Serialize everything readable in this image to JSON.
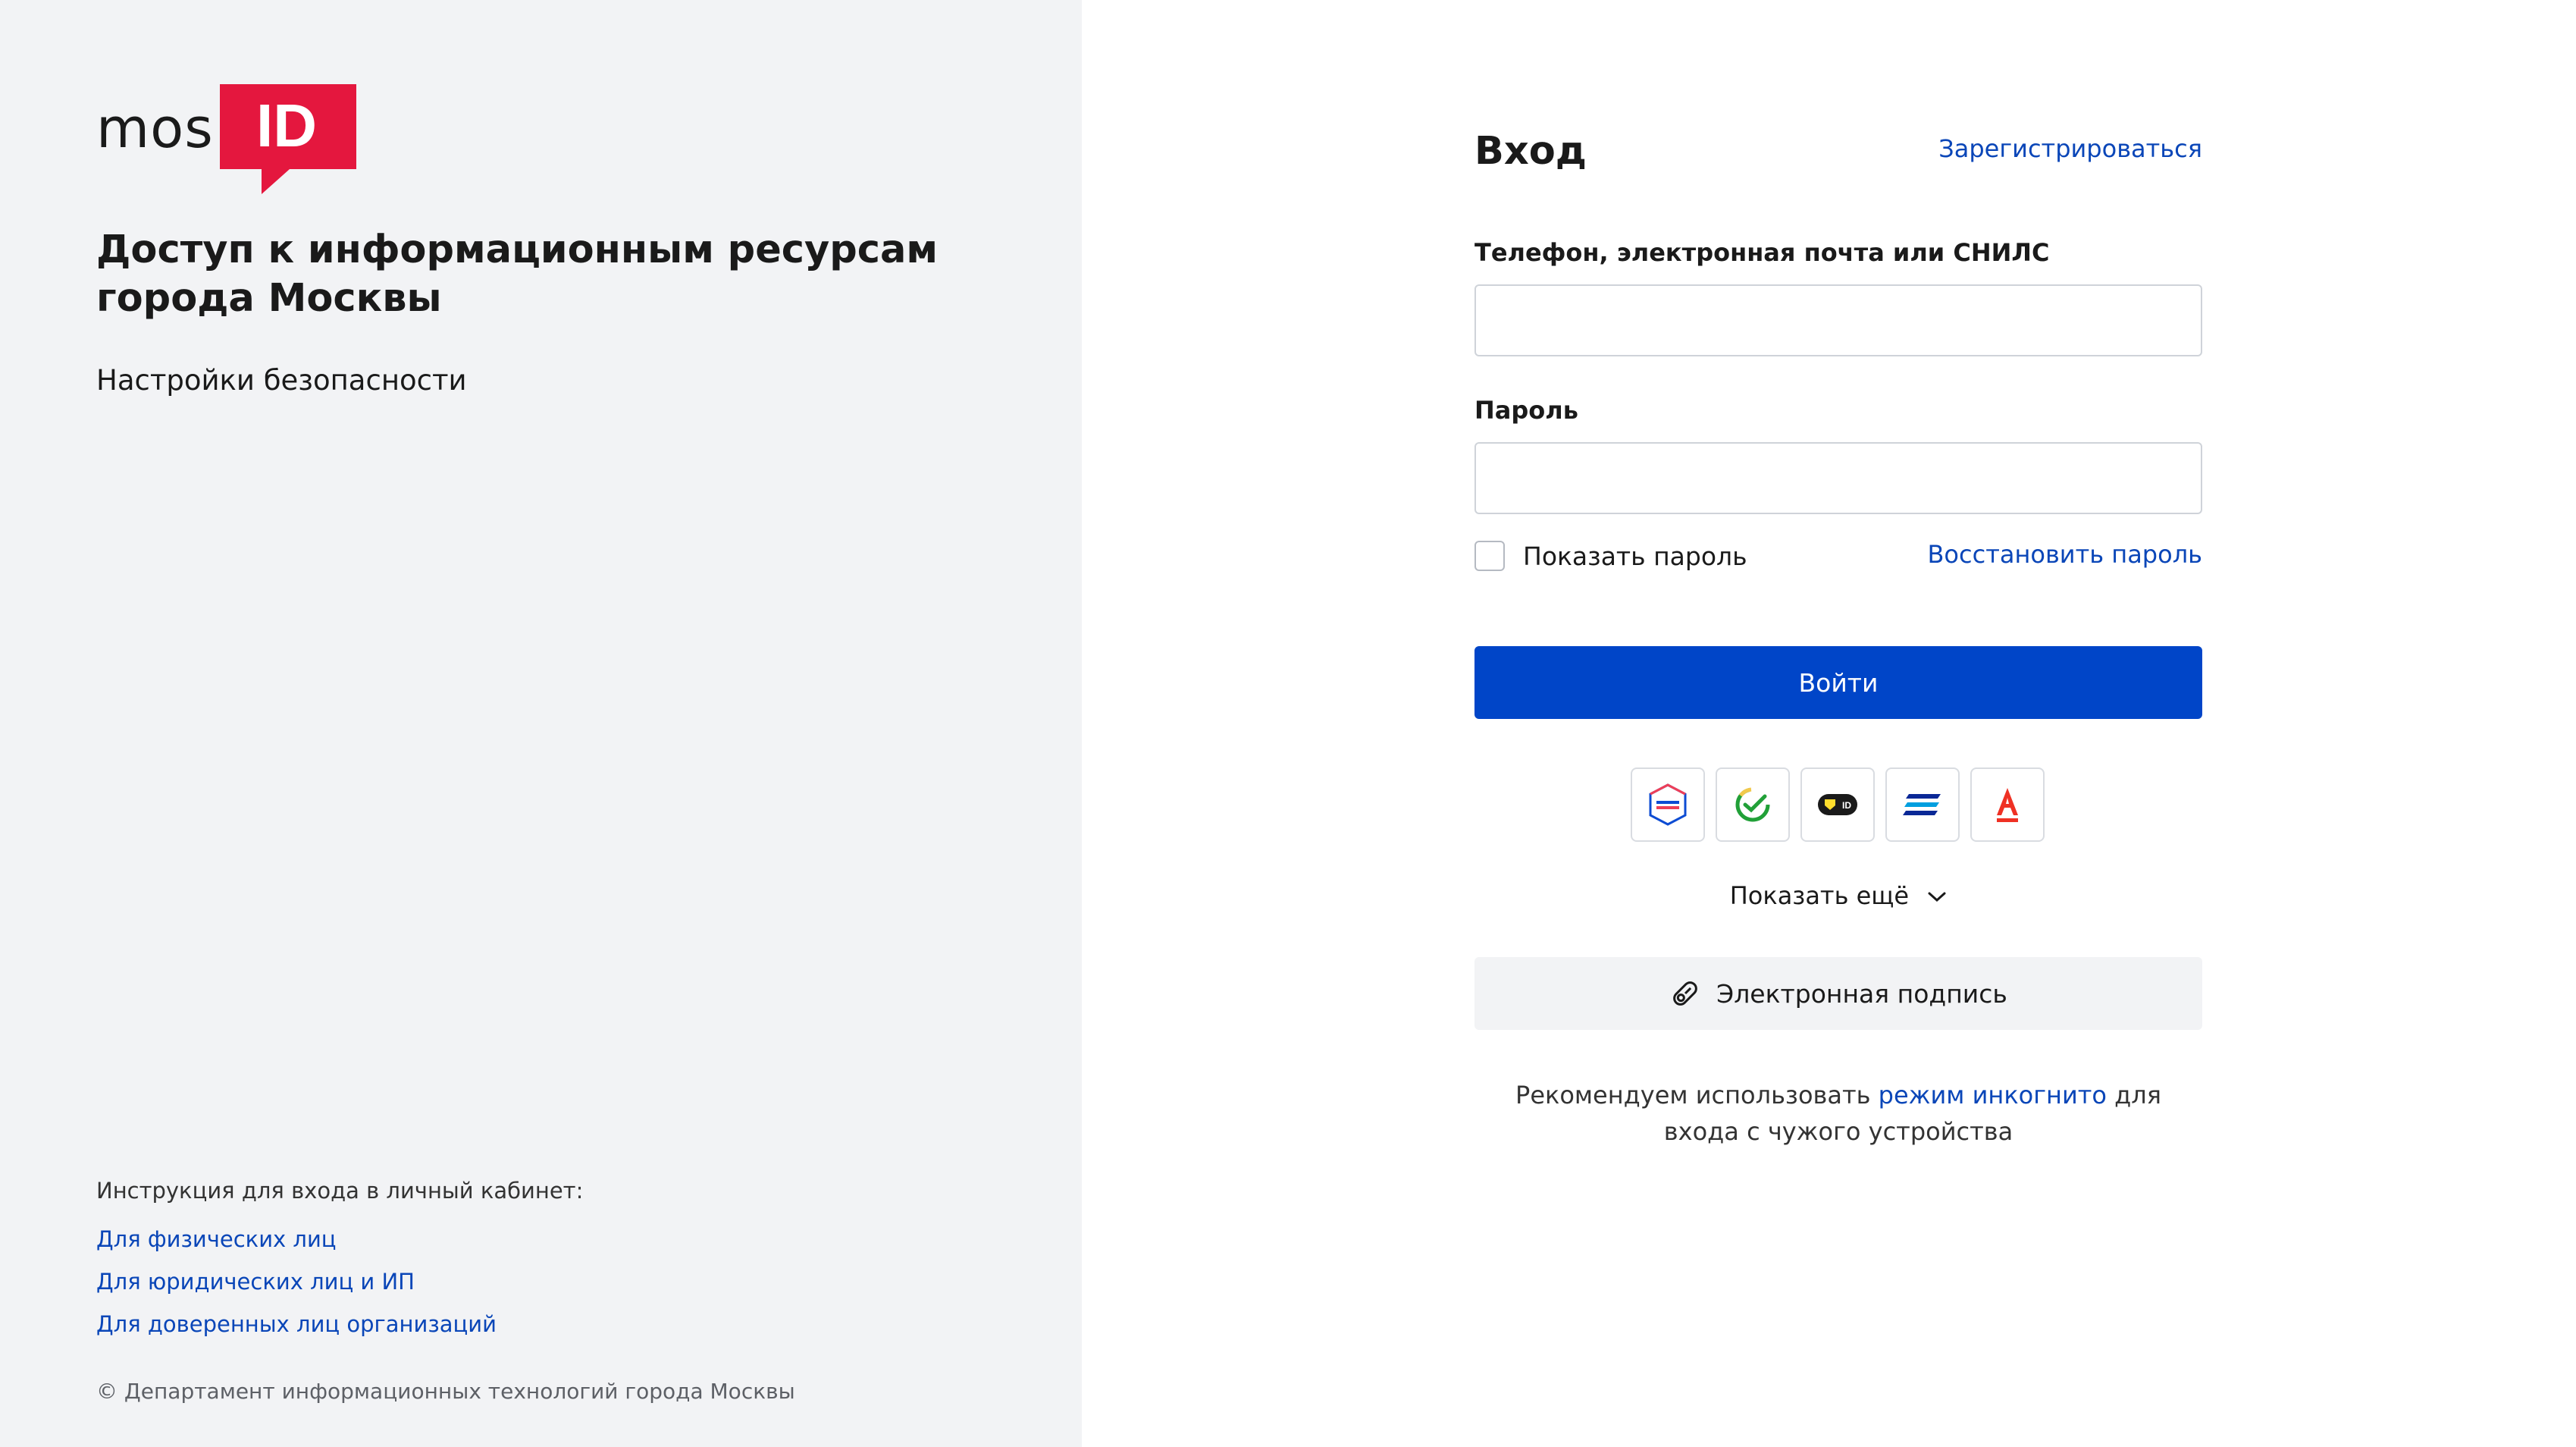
{
  "brand": {
    "logo_text": "mos",
    "logo_badge": "ID",
    "accent_color": "#e4173e"
  },
  "left": {
    "heading": "Доступ к информационным ресурсам города Москвы",
    "subtitle": "Настройки безопасности",
    "instructions_title": "Инструкция для входа в личный кабинет:",
    "instruction_links": [
      "Для физических лиц",
      "Для юридических лиц и ИП",
      "Для доверенных лиц организаций"
    ],
    "copyright": "© Департамент информационных технологий города Москвы"
  },
  "form": {
    "title": "Вход",
    "register_link": "Зарегистрироваться",
    "login_label": "Телефон, электронная почта или СНИЛС",
    "login_value": "",
    "password_label": "Пароль",
    "password_value": "",
    "show_password_label": "Показать пароль",
    "show_password_checked": false,
    "restore_link": "Восстановить пароль",
    "submit_label": "Войти",
    "primary_color": "#0045c8",
    "providers": [
      {
        "name": "gosuslugi-icon",
        "label": "Госуслуги"
      },
      {
        "name": "sber-id-icon",
        "label": "Сбер ID"
      },
      {
        "name": "tinkoff-id-icon",
        "label": "T-ID"
      },
      {
        "name": "vtb-icon",
        "label": "ВТБ"
      },
      {
        "name": "alfa-bank-icon",
        "label": "Альфа-Банк"
      }
    ],
    "show_more_label": "Показать ещё",
    "esign_label": "Электронная подпись",
    "recommend_before": "Рекомендуем использовать ",
    "recommend_link": "режим инкогнито",
    "recommend_after": " для входа с чужого устройства"
  }
}
